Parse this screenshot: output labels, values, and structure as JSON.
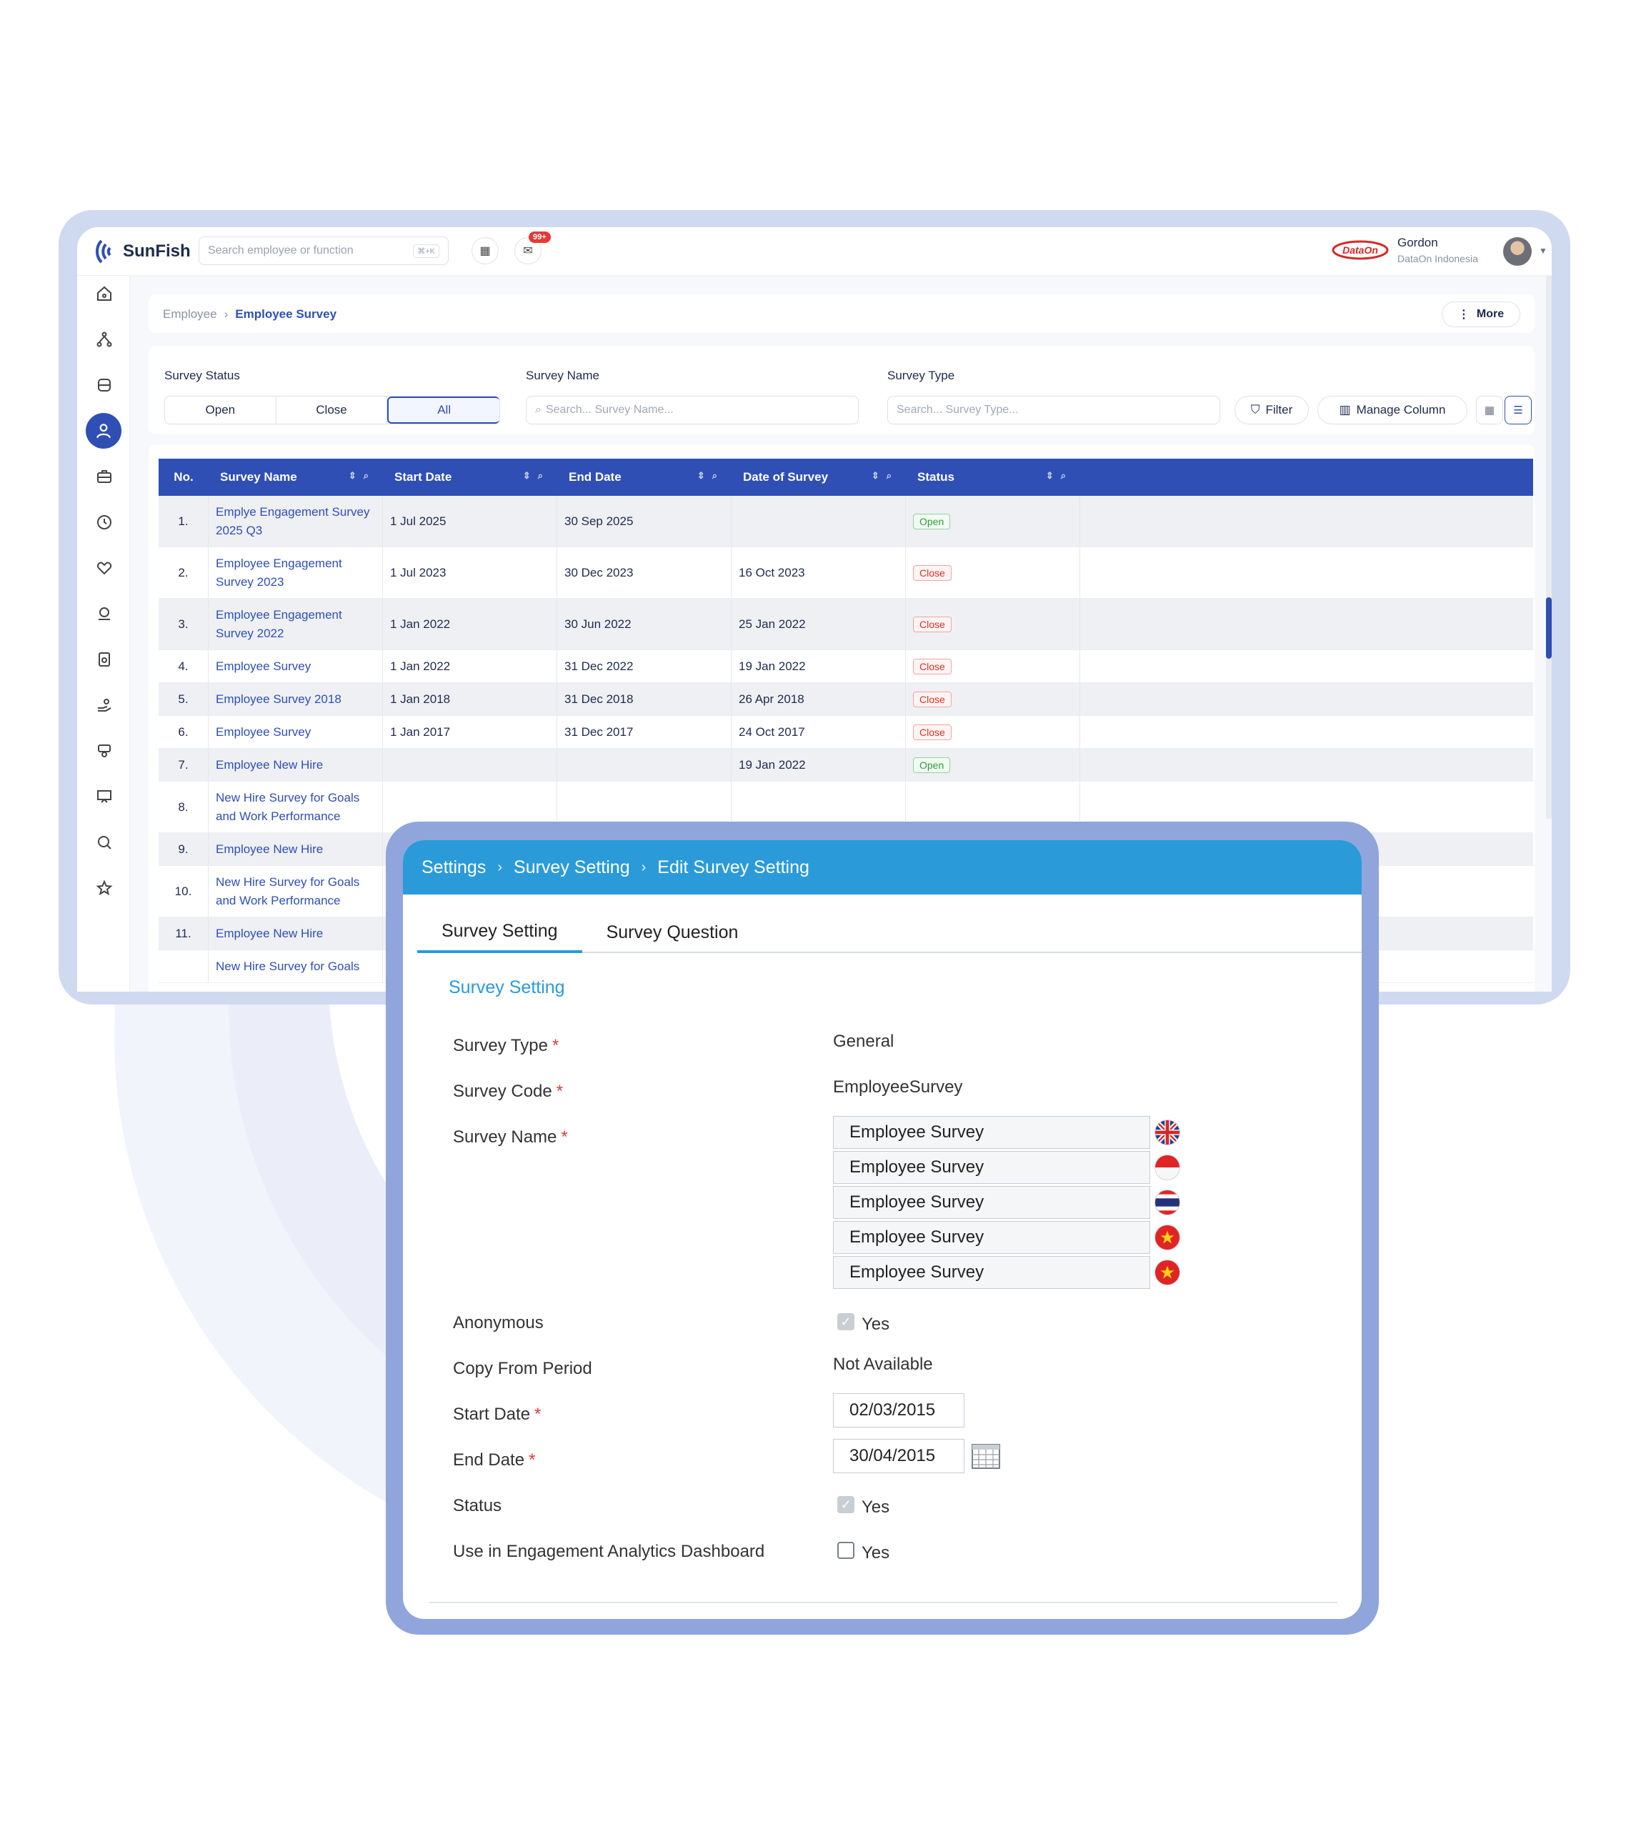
{
  "app": {
    "brand": "SunFish",
    "search_placeholder": "Search employee or function",
    "search_shortcut": "⌘+K",
    "notif_badge": "99+",
    "user_name": "Gordon",
    "user_company": "DataOn Indonesia",
    "company_logo_text": "DataOn"
  },
  "breadcrumb": {
    "parent": "Employee",
    "current": "Employee Survey",
    "more_label": "More"
  },
  "filters": {
    "status_label": "Survey Status",
    "status_options": [
      "Open",
      "Close",
      "All"
    ],
    "status_selected": "All",
    "name_label": "Survey Name",
    "name_placeholder": "Search... Survey Name...",
    "type_label": "Survey Type",
    "type_placeholder": "Search... Survey Type...",
    "filter_label": "Filter",
    "manage_column_label": "Manage Column"
  },
  "table": {
    "columns": [
      "No.",
      "Survey Name",
      "Start Date",
      "End Date",
      "Date of Survey",
      "Status"
    ],
    "rows": [
      {
        "no": "1.",
        "name": "Emplye Engagement Survey 2025 Q3",
        "start": "1 Jul 2025",
        "end": "30 Sep 2025",
        "date": "",
        "status": "Open"
      },
      {
        "no": "2.",
        "name": "Employee Engagement Survey 2023",
        "start": "1 Jul 2023",
        "end": "30 Dec 2023",
        "date": "16 Oct 2023",
        "status": "Close"
      },
      {
        "no": "3.",
        "name": "Employee Engagement Survey 2022",
        "start": "1 Jan 2022",
        "end": "30 Jun 2022",
        "date": "25 Jan 2022",
        "status": "Close"
      },
      {
        "no": "4.",
        "name": "Employee Survey",
        "start": "1 Jan 2022",
        "end": "31 Dec 2022",
        "date": "19 Jan 2022",
        "status": "Close"
      },
      {
        "no": "5.",
        "name": "Employee Survey 2018",
        "start": "1 Jan 2018",
        "end": "31 Dec 2018",
        "date": "26 Apr 2018",
        "status": "Close"
      },
      {
        "no": "6.",
        "name": "Employee Survey",
        "start": "1 Jan 2017",
        "end": "31 Dec 2017",
        "date": "24 Oct 2017",
        "status": "Close"
      },
      {
        "no": "7.",
        "name": "Employee New Hire",
        "start": "",
        "end": "",
        "date": "19 Jan 2022",
        "status": "Open"
      },
      {
        "no": "8.",
        "name": "New Hire Survey for Goals and Work Performance",
        "start": "",
        "end": "",
        "date": "",
        "status": ""
      },
      {
        "no": "9.",
        "name": "Employee New Hire",
        "start": "",
        "end": "",
        "date": "",
        "status": ""
      },
      {
        "no": "10.",
        "name": "New Hire Survey for Goals and Work Performance",
        "start": "",
        "end": "",
        "date": "",
        "status": ""
      },
      {
        "no": "11.",
        "name": "Employee New Hire",
        "start": "",
        "end": "",
        "date": "",
        "status": ""
      },
      {
        "no": "",
        "name": "New Hire Survey for Goals",
        "start": "",
        "end": "",
        "date": "",
        "status": ""
      }
    ]
  },
  "dialog": {
    "breadcrumb": [
      "Settings",
      "Survey Setting",
      "Edit Survey Setting"
    ],
    "tabs": [
      "Survey Setting",
      "Survey Question"
    ],
    "section_title": "Survey Setting",
    "fields": {
      "survey_type_label": "Survey Type",
      "survey_type_value": "General",
      "survey_code_label": "Survey Code",
      "survey_code_value": "EmployeeSurvey",
      "survey_name_label": "Survey Name",
      "survey_name_values": [
        "Employee Survey",
        "Employee Survey",
        "Employee Survey",
        "Employee Survey",
        "Employee Survey"
      ],
      "anonymous_label": "Anonymous",
      "anonymous_value": "Yes",
      "copy_label": "Copy From Period",
      "copy_value": "Not Available",
      "start_label": "Start Date",
      "start_value": "02/03/2015",
      "end_label": "End Date",
      "end_value": "30/04/2015",
      "status_label": "Status",
      "status_value": "Yes",
      "analytics_label": "Use in Engagement Analytics Dashboard",
      "analytics_value": "Yes"
    },
    "required_mark": "*"
  }
}
